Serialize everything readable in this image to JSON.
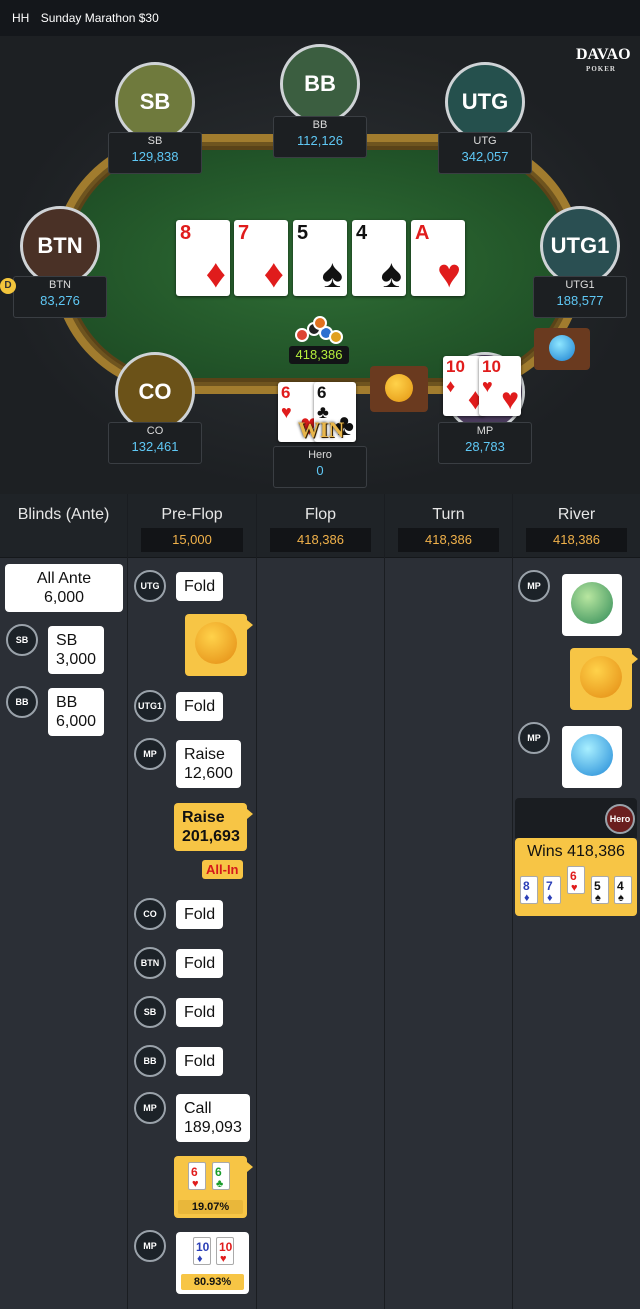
{
  "header": {
    "hh": "HH",
    "title": "Sunday Marathon $30"
  },
  "logo": {
    "name": "DAVAO",
    "sub": "POKER"
  },
  "seats": {
    "sb": {
      "avatar": "SB",
      "name": "SB",
      "stack": "129,838",
      "color": "#6f7a3d"
    },
    "bb": {
      "avatar": "BB",
      "name": "BB",
      "stack": "112,126",
      "color": "#3b5e40"
    },
    "utg": {
      "avatar": "UTG",
      "name": "UTG",
      "stack": "342,057",
      "color": "#25504d"
    },
    "btn": {
      "avatar": "BTN",
      "name": "BTN",
      "stack": "83,276",
      "color": "#4a3126",
      "dealer": "D"
    },
    "utg1": {
      "avatar": "UTG1",
      "name": "UTG1",
      "stack": "188,577",
      "color": "#2a4f52"
    },
    "co": {
      "avatar": "CO",
      "name": "CO",
      "stack": "132,461",
      "color": "#6b5218"
    },
    "mp": {
      "name": "MP",
      "stack": "28,783"
    },
    "hero": {
      "name": "Hero",
      "stack": "0",
      "win": "WIN"
    }
  },
  "board": [
    {
      "rank": "8",
      "suit": "♦"
    },
    {
      "rank": "7",
      "suit": "♦"
    },
    {
      "rank": "5",
      "suit": "♠"
    },
    {
      "rank": "4",
      "suit": "♠"
    },
    {
      "rank": "A",
      "suit": "♥"
    }
  ],
  "pot": "418,386",
  "hero_cards": [
    {
      "rank": "6",
      "suit": "♥"
    },
    {
      "rank": "6",
      "suit": "♣"
    }
  ],
  "mp_cards": [
    {
      "rank": "10",
      "suit": "♦"
    },
    {
      "rank": "10",
      "suit": "♥"
    }
  ],
  "history": {
    "columns": [
      {
        "title": "Blinds (Ante)",
        "value": ""
      },
      {
        "title": "Pre-Flop",
        "value": "15,000"
      },
      {
        "title": "Flop",
        "value": "418,386"
      },
      {
        "title": "Turn",
        "value": "418,386"
      },
      {
        "title": "River",
        "value": "418,386"
      }
    ],
    "blinds": {
      "ante_label": "All Ante",
      "ante_value": "6,000",
      "sb_pos": "SB",
      "sb_label": "SB",
      "sb_value": "3,000",
      "bb_pos": "BB",
      "bb_label": "BB",
      "bb_value": "6,000"
    },
    "preflop": {
      "utg_pos": "UTG",
      "utg_act": "Fold",
      "utg1_pos": "UTG1",
      "utg1_act": "Fold",
      "mp_pos": "MP",
      "mp_act": "Raise",
      "mp_amt": "12,600",
      "hero_act": "Raise",
      "hero_amt": "201,693",
      "allin": "All-In",
      "co_pos": "CO",
      "co_act": "Fold",
      "btn_pos": "BTN",
      "btn_act": "Fold",
      "sb_pos": "SB",
      "sb_act": "Fold",
      "bb_pos": "BB",
      "bb_act": "Fold",
      "mp2_pos": "MP",
      "mp2_act": "Call",
      "mp2_amt": "189,093",
      "hero_eq": "19.07%",
      "mp3_pos": "MP",
      "mp_eq": "80.93%"
    },
    "river": {
      "mp_pos": "MP",
      "mp2_pos": "MP",
      "hero_pos": "Hero",
      "wins": "Wins 418,386",
      "final": [
        {
          "rank": "8",
          "suit": "♦"
        },
        {
          "rank": "7",
          "suit": "♦"
        },
        {
          "rank": "6",
          "suit": "♥"
        },
        {
          "rank": "5",
          "suit": "♠"
        },
        {
          "rank": "4",
          "suit": "♠"
        }
      ]
    }
  }
}
